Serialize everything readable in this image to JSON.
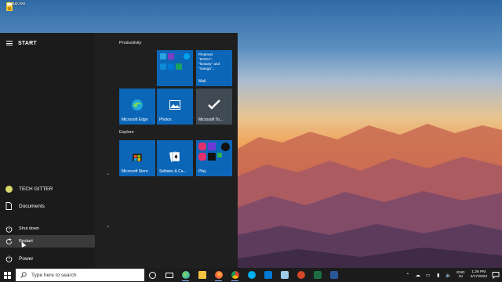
{
  "desktop": {
    "icon_label": "Setup.exe",
    "icon_name": "setup-exe-icon"
  },
  "start_menu": {
    "title": "START",
    "rail": {
      "user": "TECH GITTER",
      "documents": "Documents",
      "shutdown": "Shut down",
      "restart": "Restart",
      "power": "Power"
    },
    "groups": [
      {
        "label": "Productivity",
        "tiles": [
          {
            "label": "",
            "icon": "office-apps-folder-icon"
          },
          {
            "label": "Mail",
            "icon": "mail-icon",
            "lines": [
              "Pinterest",
              "\"DOGA\",",
              "\"fantasy\" and",
              "\"manga\"..."
            ]
          },
          {
            "label": "Microsoft Edge",
            "icon": "edge-icon"
          },
          {
            "label": "Photos",
            "icon": "photos-icon"
          },
          {
            "label": "Microsoft To...",
            "icon": "todo-icon"
          }
        ]
      },
      {
        "label": "Explore",
        "tiles": [
          {
            "label": "Microsoft Store",
            "icon": "store-icon"
          },
          {
            "label": "Solitaire & Ca...",
            "icon": "solitaire-icon"
          },
          {
            "label": "Play",
            "icon": "play-folder-icon"
          }
        ]
      }
    ]
  },
  "taskbar": {
    "search_placeholder": "Type here to search",
    "apps": [
      "cortana-icon",
      "task-view-icon",
      "edge-icon",
      "file-explorer-icon",
      "firefox-icon",
      "chrome-icon",
      "skype-icon",
      "store-icon",
      "notepad-icon",
      "powerpoint-icon",
      "excel-icon",
      "word-icon"
    ],
    "tray": {
      "lang_line1": "ENG",
      "lang_line2": "IN",
      "time": "1:26 PM",
      "date": "4/17/2023"
    }
  },
  "colors": {
    "tile_blue": "#0c66b8",
    "menu_bg": "#1f1f1f",
    "taskbar_bg": "#1c1c1c"
  }
}
